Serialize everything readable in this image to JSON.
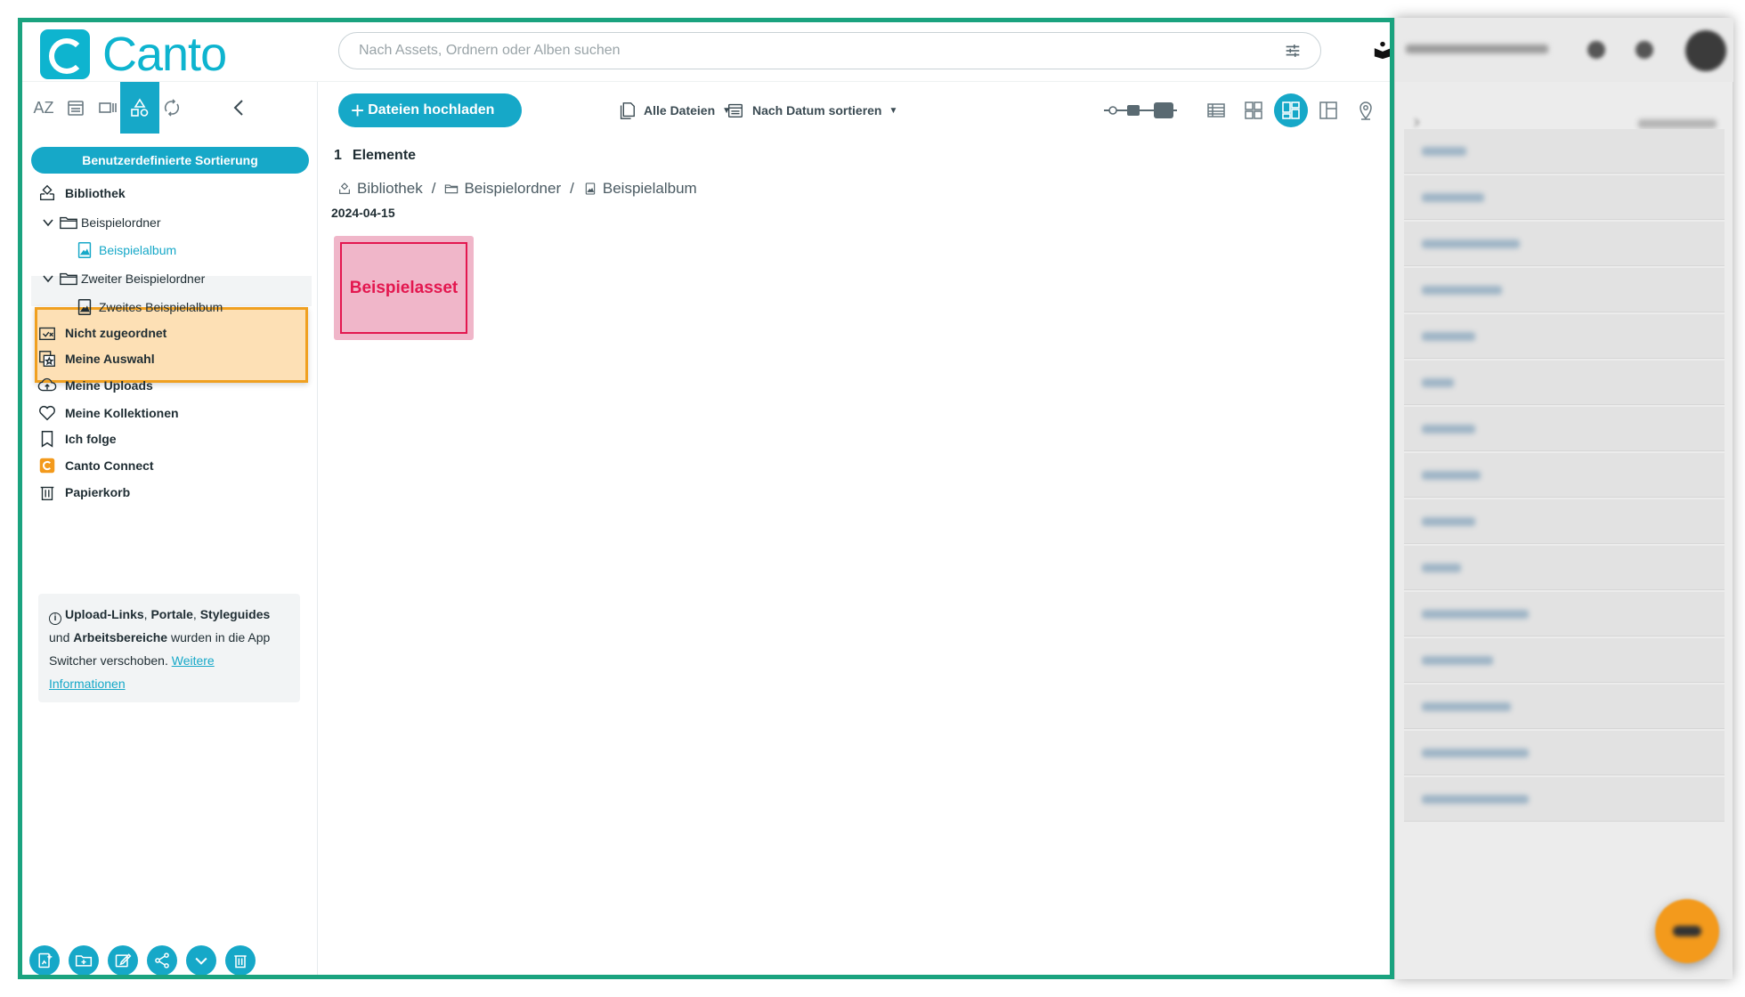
{
  "app": {
    "logo_text": "Canto",
    "search_placeholder": "Nach Assets, Ordnern oder Alben suchen"
  },
  "sidebar": {
    "sort_tool_labels": [
      "AZ"
    ],
    "sort_button": "Benutzerdefinierte Sortierung",
    "library": "Bibliothek",
    "tree": [
      {
        "label": "Beispielordner",
        "type": "folder",
        "children": [
          {
            "label": "Beispielalbum",
            "type": "album",
            "selected": true
          }
        ]
      },
      {
        "label": "Zweiter Beispielordner",
        "type": "folder",
        "highlighted": true,
        "children": [
          {
            "label": "Zweites Beispielalbum",
            "type": "album"
          }
        ]
      }
    ],
    "items": [
      {
        "label": "Nicht zugeordnet",
        "icon": "unassigned-icon"
      },
      {
        "label": "Meine Auswahl",
        "icon": "star-selection-icon"
      },
      {
        "label": "Meine Uploads",
        "icon": "cloud-upload-icon"
      },
      {
        "label": "Meine Kollektionen",
        "icon": "heart-icon"
      },
      {
        "label": "Ich folge",
        "icon": "bookmark-icon"
      },
      {
        "label": "Canto Connect",
        "icon": "canto-connect-icon"
      },
      {
        "label": "Papierkorb",
        "icon": "trash-icon"
      }
    ],
    "info": {
      "b1": "Upload-Links",
      "t1": ", ",
      "b2": "Portale",
      "t2": ", ",
      "b3": "Styleguides",
      "t3": " und ",
      "b4": "Arbeitsbereiche",
      "t4": " wurden in die App Switcher verschoben. ",
      "link": "Weitere Informationen"
    }
  },
  "toolbar": {
    "upload_label": "Dateien hochladen",
    "filter_label": "Alle Dateien",
    "sort_label": "Nach Datum sortieren"
  },
  "content": {
    "count": "1",
    "count_label": "Elemente",
    "breadcrumb": [
      "Bibliothek",
      "Beispielordner",
      "Beispielalbum"
    ],
    "date": "2024-04-15",
    "asset_label": "Beispielasset"
  },
  "colors": {
    "accent": "#16a8c8",
    "frame": "#1aa37f",
    "highlight_border": "#f0a020",
    "highlight_bg": "#fde0b5",
    "asset_bg": "#f0b6c9",
    "asset_text": "#e3174f"
  }
}
